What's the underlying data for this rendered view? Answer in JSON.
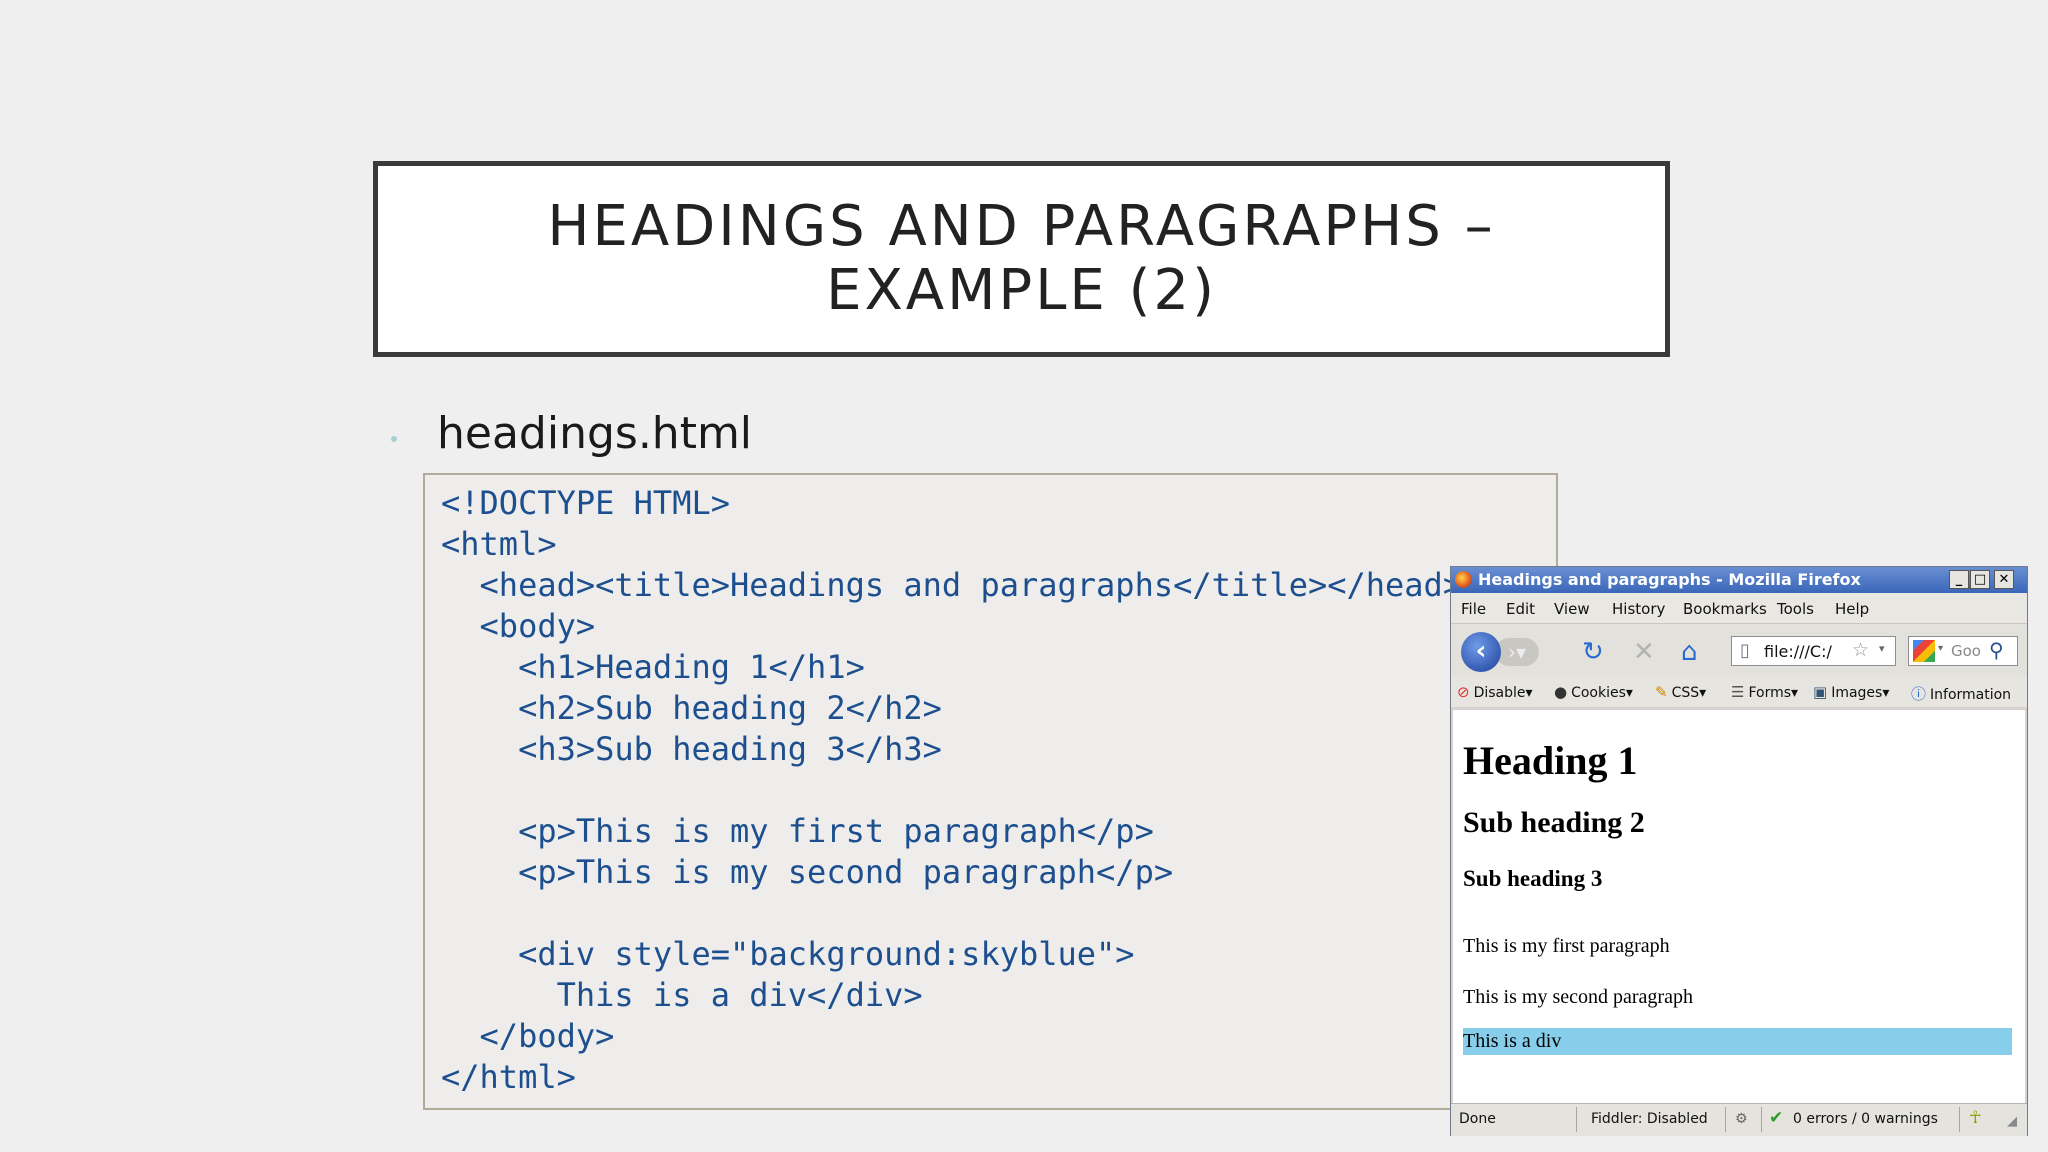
{
  "slide": {
    "title_lines": [
      "HEADINGS AND PARAGRAPHS –",
      "EXAMPLE (2)"
    ],
    "bullet": "headings.html"
  },
  "code": {
    "lines": [
      "<!DOCTYPE HTML>",
      "<html>",
      "  <head><title>Headings and paragraphs</title></head>",
      "  <body>",
      "    <h1>Heading 1</h1>",
      "    <h2>Sub heading 2</h2>",
      "    <h3>Sub heading 3</h3>",
      "",
      "    <p>This is my first paragraph</p>",
      "    <p>This is my second paragraph</p>",
      "",
      "    <div style=\"background:skyblue\">",
      "      This is a div</div>",
      "  </body>",
      "</html>"
    ]
  },
  "browser": {
    "window_title": "Headings and paragraphs - Mozilla Firefox",
    "window_buttons": [
      "_",
      "□",
      "✕"
    ],
    "menu": [
      "File",
      "Edit",
      "View",
      "History",
      "Bookmarks",
      "Tools",
      "Help"
    ],
    "url": "file:///C:/",
    "search_placeholder": "Goo",
    "toolbar": [
      "Disable",
      "Cookies",
      "CSS",
      "Forms",
      "Images",
      "Information"
    ],
    "page": {
      "h1": "Heading 1",
      "h2": "Sub heading 2",
      "h3": "Sub heading 3",
      "p1": "This is my first paragraph",
      "p2": "This is my second paragraph",
      "div_text": "This is a div",
      "div_color": "#87ceeb"
    },
    "status": {
      "done": "Done",
      "fiddler": "Fiddler: Disabled",
      "errors": "0 errors / 0 warnings"
    }
  }
}
